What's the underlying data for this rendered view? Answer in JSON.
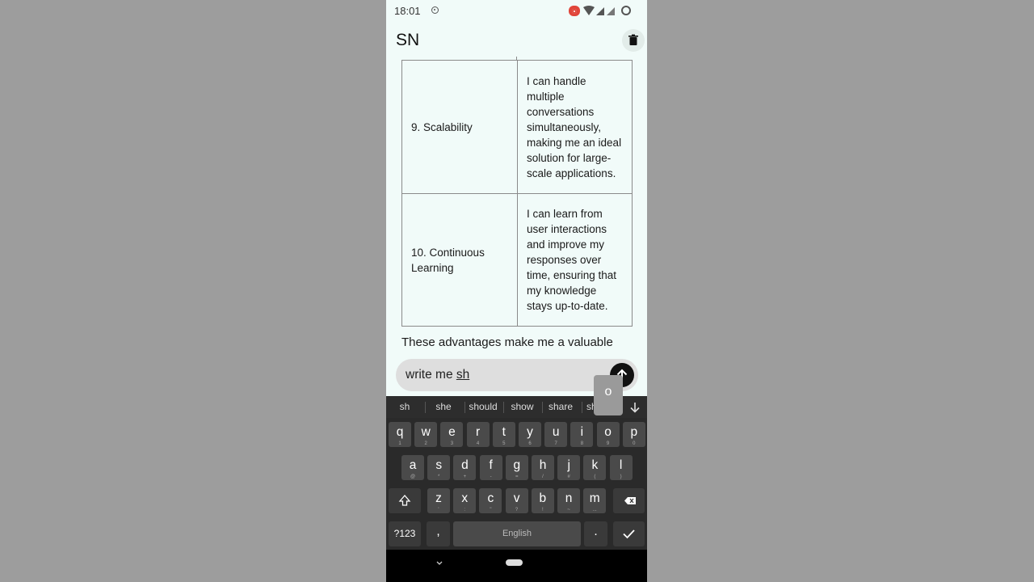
{
  "status_bar": {
    "time": "18:01"
  },
  "app": {
    "title": "SN"
  },
  "table": {
    "rows": [
      {
        "feature": "9. Scalability",
        "description": "I can handle multiple conversations simultaneously, making me an ideal solution for large-scale applications."
      },
      {
        "feature": "10. Continuous Learning",
        "description": "I can learn from user interactions and improve my responses over time, ensuring that my knowledge stays up-to-date."
      }
    ]
  },
  "outro_text": "These advantages make me a valuable",
  "input": {
    "prefix": "write me ",
    "composing": "sh"
  },
  "keyboard": {
    "popup_key": "o",
    "suggestions": [
      "sh",
      "she",
      "should",
      "show",
      "share",
      "sh"
    ],
    "more_label": "...",
    "row1": [
      {
        "l": "q",
        "h": "1"
      },
      {
        "l": "w",
        "h": "2"
      },
      {
        "l": "e",
        "h": "3"
      },
      {
        "l": "r",
        "h": "4"
      },
      {
        "l": "t",
        "h": "5"
      },
      {
        "l": "y",
        "h": "6"
      },
      {
        "l": "u",
        "h": "7"
      },
      {
        "l": "i",
        "h": "8"
      },
      {
        "l": "o",
        "h": "9"
      },
      {
        "l": "p",
        "h": "0"
      }
    ],
    "row2": [
      {
        "l": "a",
        "h": "@"
      },
      {
        "l": "s",
        "h": "*"
      },
      {
        "l": "d",
        "h": "+"
      },
      {
        "l": "f",
        "h": "-"
      },
      {
        "l": "g",
        "h": "="
      },
      {
        "l": "h",
        "h": "/"
      },
      {
        "l": "j",
        "h": "#"
      },
      {
        "l": "k",
        "h": "("
      },
      {
        "l": "l",
        "h": ")"
      }
    ],
    "row3": [
      {
        "l": "z",
        "h": "'"
      },
      {
        "l": "x",
        "h": ":"
      },
      {
        "l": "c",
        "h": "\""
      },
      {
        "l": "v",
        "h": "?"
      },
      {
        "l": "b",
        "h": "!"
      },
      {
        "l": "n",
        "h": "~"
      },
      {
        "l": "m",
        "h": "..."
      }
    ],
    "symbols_label": "?123",
    "comma": ",",
    "space_label": "English",
    "period": "."
  },
  "icons": {
    "status": [
      "settings-dot-icon",
      "record-icon",
      "wifi-icon",
      "signal-icon",
      "battery-icon"
    ],
    "trash": "trash-icon",
    "send": "arrow-up-icon",
    "shift": "shift-icon",
    "backspace": "backspace-icon",
    "enter": "check-icon",
    "collapse": "arrow-down-icon",
    "nav_back": "chevron-down-icon"
  }
}
